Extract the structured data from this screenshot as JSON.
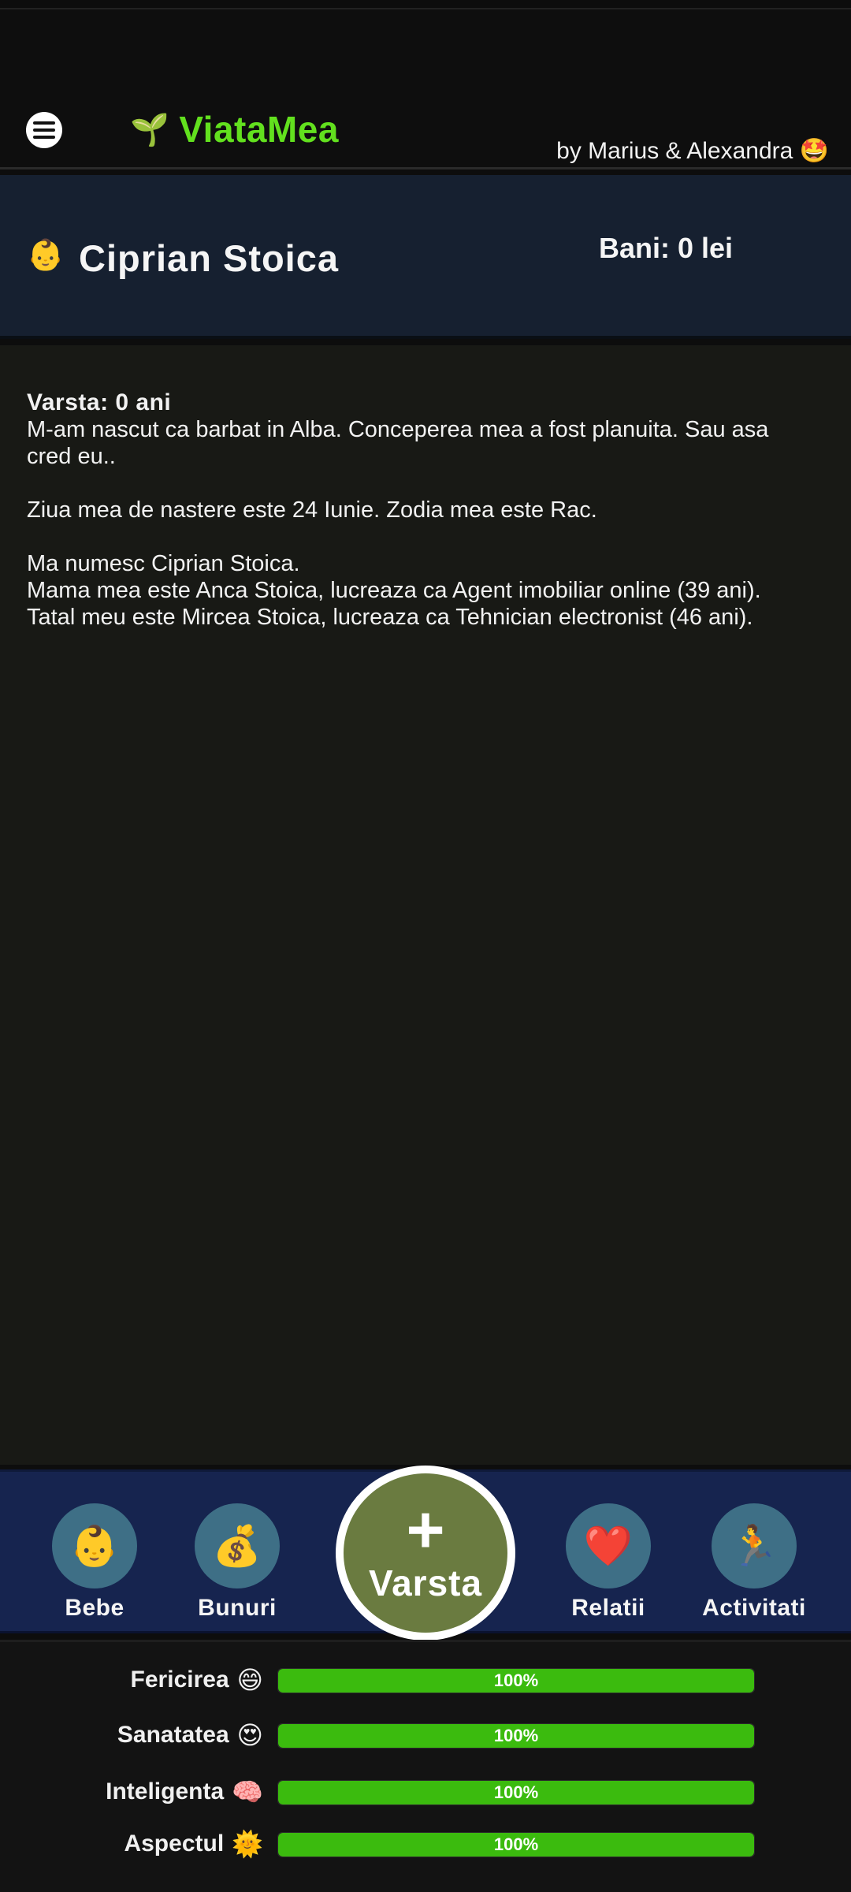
{
  "header": {
    "brand_icon": "🌱",
    "brand_name": "ViataMea",
    "byline": "by Marius & Alexandra 🤩"
  },
  "profile": {
    "avatar_icon": "👶",
    "name": "Ciprian Stoica",
    "money": "Bani: 0 lei"
  },
  "log": {
    "age_line": "Varsta: 0 ani",
    "line1": "M-am nascut ca barbat in Alba. Conceperea mea a fost planuita. Sau asa cred eu..",
    "line2": "Ziua mea de nastere este 24 Iunie. Zodia mea este Rac.",
    "line3": "Ma numesc Ciprian Stoica.",
    "line4": "Mama mea este Anca Stoica, lucreaza ca Agent imobiliar online (39 ani).",
    "line5": "Tatal meu este Mircea Stoica, lucreaza ca Tehnician electronist (46 ani)."
  },
  "nav": {
    "items": [
      {
        "label": "Bebe",
        "icon": "👶"
      },
      {
        "label": "Bunuri",
        "icon": "💰"
      },
      {
        "label": "Relatii",
        "icon": "❤️"
      },
      {
        "label": "Activitati",
        "icon": "🏃"
      }
    ],
    "age_button": {
      "plus": "+",
      "label": "Varsta"
    }
  },
  "stats": [
    {
      "label": "Fericirea",
      "icon": "😄",
      "value": 100,
      "text": "100%"
    },
    {
      "label": "Sanatatea",
      "icon": "😍",
      "value": 100,
      "text": "100%"
    },
    {
      "label": "Inteligenta",
      "icon": "🧠",
      "value": 100,
      "text": "100%"
    },
    {
      "label": "Aspectul",
      "icon": "🌞",
      "value": 100,
      "text": "100%"
    }
  ],
  "colors": {
    "brand": "#62e01e",
    "bar_fill": "#3bbb0e",
    "nav_bg": "#16244f",
    "age_button": "#6a7b40"
  }
}
